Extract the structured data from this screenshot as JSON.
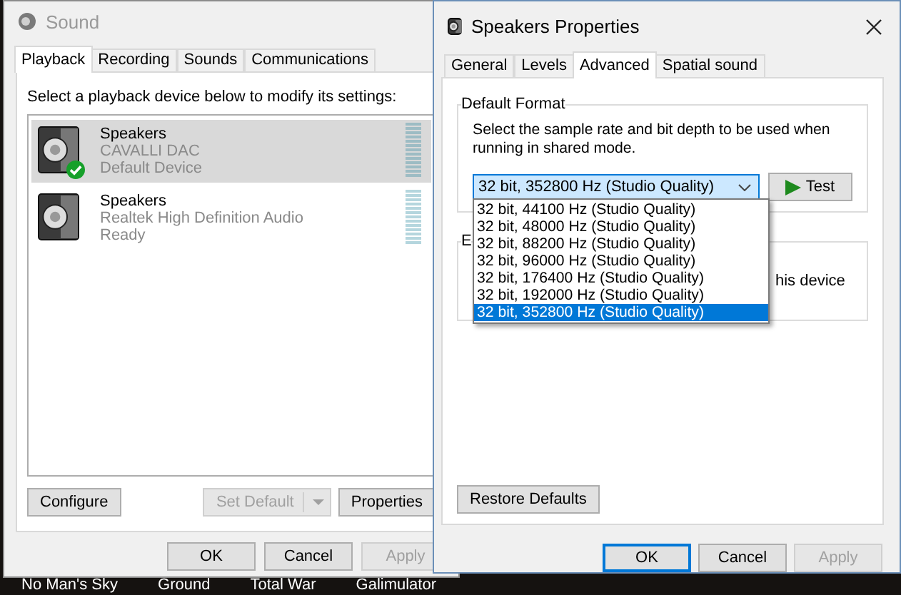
{
  "sound_window": {
    "title": "Sound",
    "active": false,
    "tabs": [
      {
        "label": "Playback",
        "selected": true
      },
      {
        "label": "Recording",
        "selected": false
      },
      {
        "label": "Sounds",
        "selected": false
      },
      {
        "label": "Communications",
        "selected": false
      }
    ],
    "instruction": "Select a playback device below to modify its settings:",
    "devices": [
      {
        "name": "Speakers",
        "device": "CAVALLI DAC",
        "status": "Default Device",
        "default": true,
        "selected": true
      },
      {
        "name": "Speakers",
        "device": "Realtek High Definition Audio",
        "status": "Ready",
        "default": false,
        "selected": false
      }
    ],
    "configure_button": {
      "label": "Configure",
      "disabled": false
    },
    "set_default_button": {
      "label": "Set Default",
      "disabled": true
    },
    "properties_button": {
      "label": "Properties",
      "disabled": false
    },
    "dialog_buttons": [
      {
        "label": "OK",
        "disabled": false,
        "default": false
      },
      {
        "label": "Cancel",
        "disabled": false,
        "default": false
      },
      {
        "label": "Apply",
        "disabled": true,
        "default": false
      }
    ]
  },
  "properties_window": {
    "title": "Speakers Properties",
    "active": true,
    "tabs": [
      {
        "label": "General",
        "selected": false
      },
      {
        "label": "Levels",
        "selected": false
      },
      {
        "label": "Advanced",
        "selected": true
      },
      {
        "label": "Spatial sound",
        "selected": false
      }
    ],
    "default_format": {
      "title": "Default Format",
      "description": "Select the sample rate and bit depth to be used when running in shared mode.",
      "format_select": {
        "value": "32 bit, 352800 Hz (Studio Quality)",
        "expanded": true,
        "options": [
          {
            "label": "32 bit, 44100 Hz (Studio Quality)",
            "selected": false
          },
          {
            "label": "32 bit, 48000 Hz (Studio Quality)",
            "selected": false
          },
          {
            "label": "32 bit, 88200 Hz (Studio Quality)",
            "selected": false
          },
          {
            "label": "32 bit, 96000 Hz (Studio Quality)",
            "selected": false
          },
          {
            "label": "32 bit, 176400 Hz (Studio Quality)",
            "selected": false
          },
          {
            "label": "32 bit, 192000 Hz (Studio Quality)",
            "selected": false
          },
          {
            "label": "32 bit, 352800 Hz (Studio Quality)",
            "selected": true
          }
        ]
      },
      "test_button": {
        "label": "Test",
        "disabled": false
      }
    },
    "second_group": {
      "title": "E",
      "text": "his device"
    },
    "restore_button": {
      "label": "Restore Defaults",
      "disabled": false
    },
    "dialog_buttons": [
      {
        "label": "OK",
        "disabled": false,
        "default": true
      },
      {
        "label": "Cancel",
        "disabled": false,
        "default": false
      },
      {
        "label": "Apply",
        "disabled": true,
        "default": false
      }
    ]
  },
  "desktop_icons": [
    "No Man's Sky",
    "Ground",
    "Total War",
    "Galimulator"
  ]
}
